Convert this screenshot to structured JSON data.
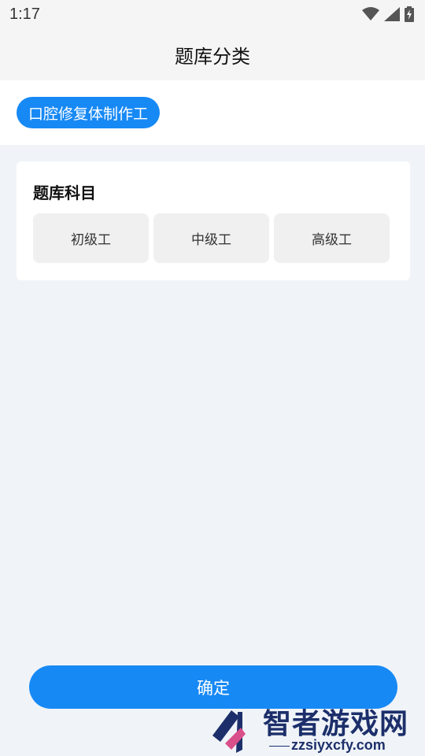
{
  "status_bar": {
    "time": "1:17"
  },
  "header": {
    "title": "题库分类"
  },
  "categories": [
    {
      "label": "口腔修复体制作工",
      "selected": true
    }
  ],
  "subject_card": {
    "title": "题库科目",
    "levels": [
      {
        "label": "初级工"
      },
      {
        "label": "中级工"
      },
      {
        "label": "高级工"
      }
    ]
  },
  "actions": {
    "confirm_label": "确定"
  },
  "watermark": {
    "text": "智者游戏网",
    "url": "zzsiyxcfy.com"
  },
  "colors": {
    "accent": "#1789f5",
    "background": "#f0f4f8",
    "chip_bg": "#f0f0f0"
  }
}
